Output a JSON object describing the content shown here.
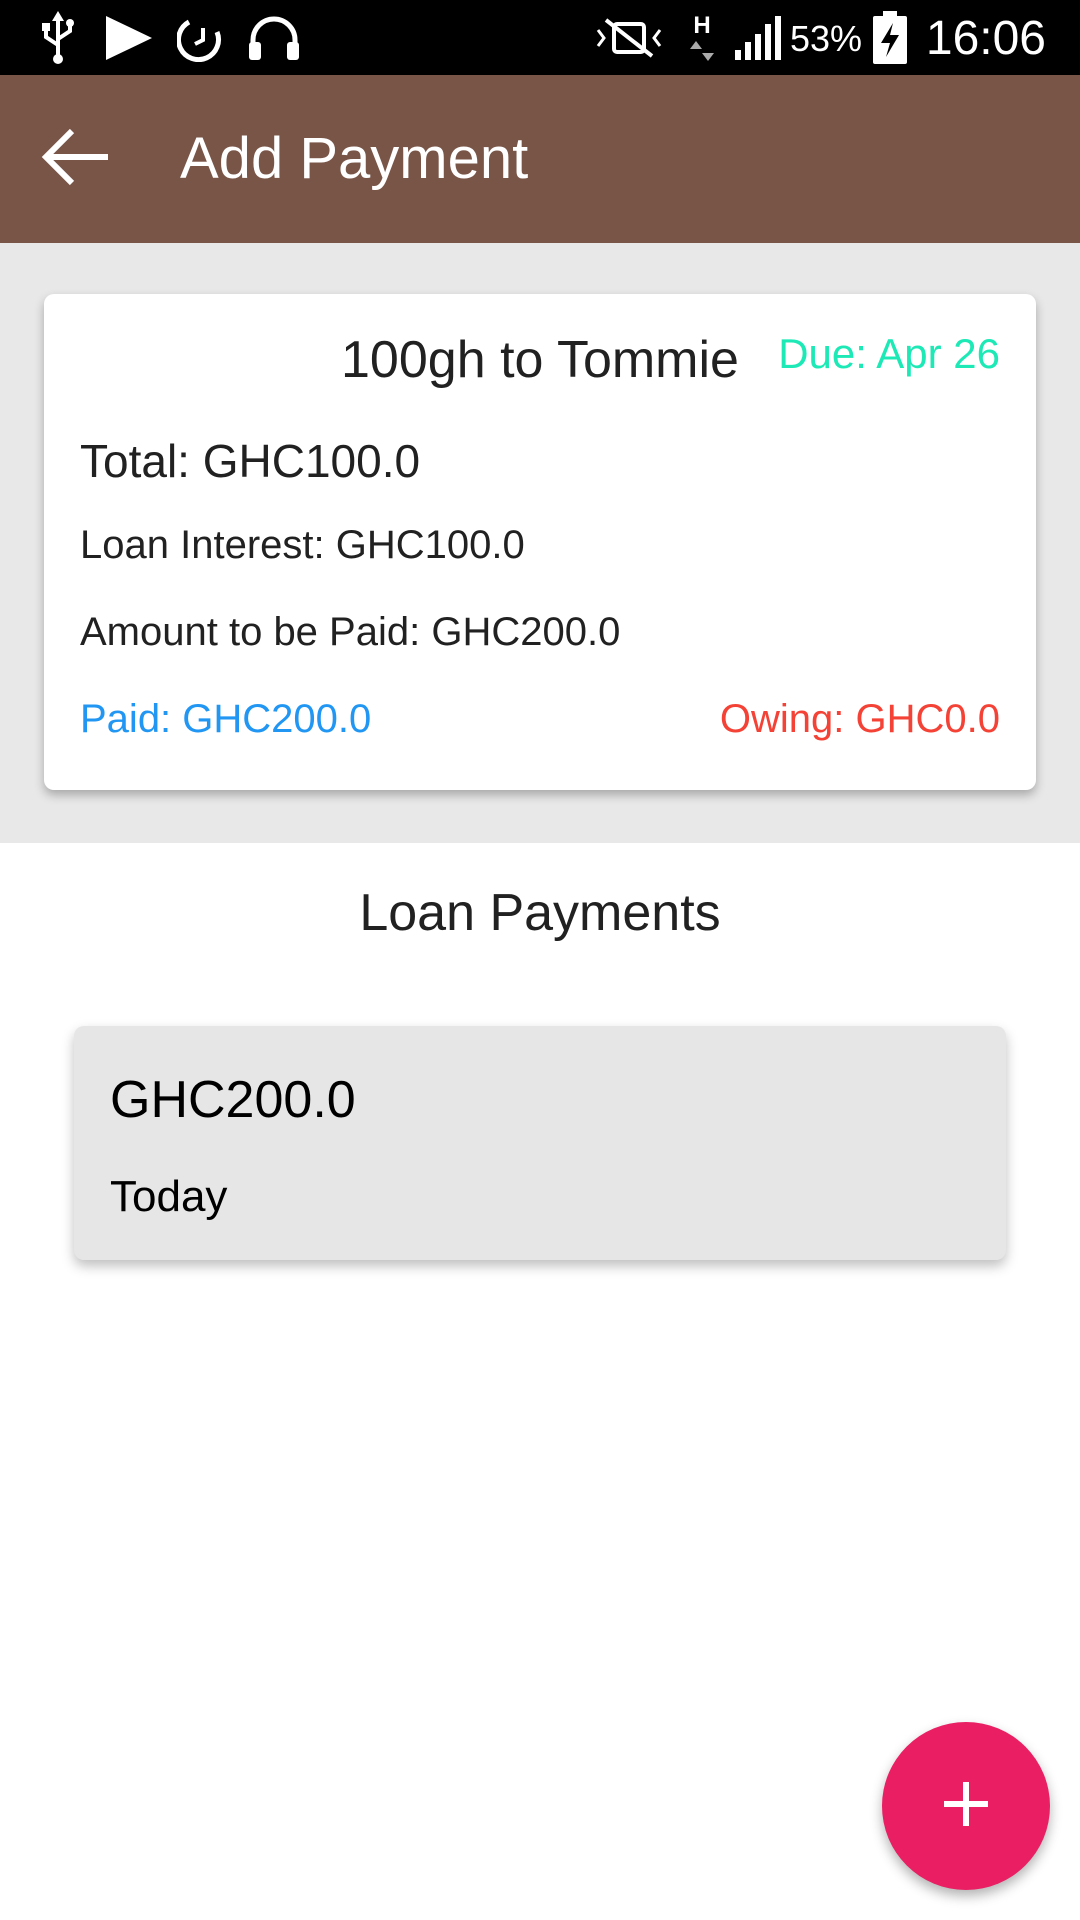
{
  "status_bar": {
    "battery_percent": "53%",
    "time": "16:06",
    "icons": [
      "usb-icon",
      "play-icon",
      "alarm-icon",
      "headphones-icon",
      "vibrate-icon",
      "network-h-icon",
      "signal-icon",
      "battery-charging-icon"
    ]
  },
  "app_bar": {
    "title": "Add Payment",
    "back_icon": "arrow-back-icon",
    "color": "#795548"
  },
  "loan": {
    "title": "100gh to Tommie",
    "due": "Due: Apr 26",
    "total": "Total: GHC100.0",
    "interest": "Loan Interest: GHC100.0",
    "amount_to_pay": "Amount to be Paid: GHC200.0",
    "paid": "Paid: GHC200.0",
    "owing": "Owing: GHC0.0"
  },
  "payments": {
    "heading": "Loan Payments",
    "items": [
      {
        "amount": "GHC200.0",
        "date": "Today"
      }
    ]
  },
  "fab": {
    "icon": "plus-icon",
    "color": "#e91e63"
  },
  "colors": {
    "due": "#1de9b6",
    "paid": "#2196f3",
    "owing": "#f44336"
  }
}
